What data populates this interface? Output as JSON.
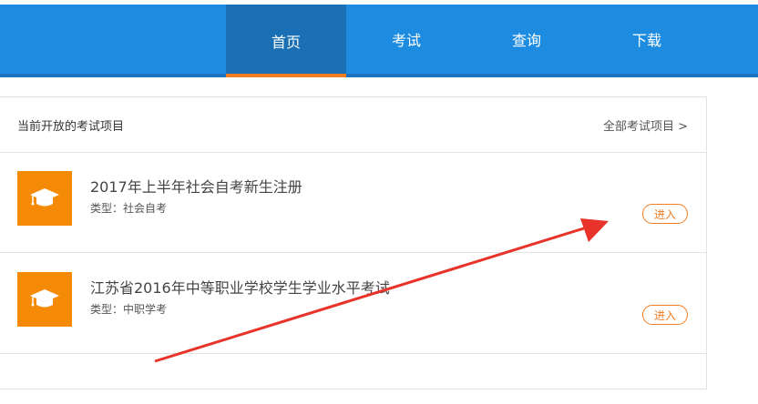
{
  "nav": {
    "items": [
      {
        "label": "首页",
        "active": true
      },
      {
        "label": "考试",
        "active": false
      },
      {
        "label": "查询",
        "active": false
      },
      {
        "label": "下载",
        "active": false
      }
    ]
  },
  "panel": {
    "title": "当前开放的考试项目",
    "more_label": "全部考试项目 >"
  },
  "exams": [
    {
      "title": "2017年上半年社会自考新生注册",
      "type_prefix": "类型：",
      "type": "社会自考",
      "enter_label": "进入"
    },
    {
      "title": "江苏省2016年中等职业学校学生学业水平考试",
      "type_prefix": "类型：",
      "type": "中职学考",
      "enter_label": "进入"
    }
  ],
  "icons": {
    "exam_icon": "graduation-cap-icon"
  },
  "colors": {
    "nav_blue": "#1d8ce0",
    "nav_active": "#1a6fb5",
    "accent_orange": "#f07c22",
    "icon_orange": "#f58a07",
    "arrow_red": "#e8332a"
  }
}
